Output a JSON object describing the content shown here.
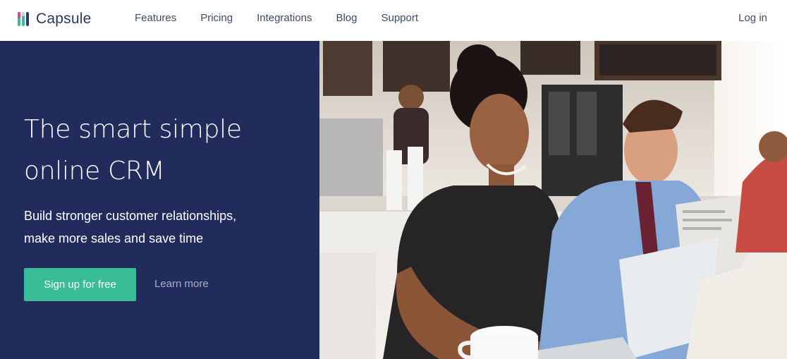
{
  "nav": {
    "logo_text": "Capsule",
    "logo_icon": "capsule-logo-icon",
    "links": [
      {
        "label": "Features"
      },
      {
        "label": "Pricing"
      },
      {
        "label": "Integrations"
      },
      {
        "label": "Blog"
      },
      {
        "label": "Support"
      }
    ],
    "login_label": "Log in"
  },
  "hero": {
    "headline_line1": "The smart simple",
    "headline_line2": "online CRM",
    "subtext_line1": "Build stronger customer relationships,",
    "subtext_line2": "make more sales and save time",
    "cta_label": "Sign up for free",
    "secondary_label": "Learn more",
    "photo_icon": "cafe-photo"
  },
  "colors": {
    "hero_bg": "#212c5c",
    "cta_bg": "#39bd97",
    "nav_text": "#3d4b66",
    "logo_text": "#273a5e"
  }
}
